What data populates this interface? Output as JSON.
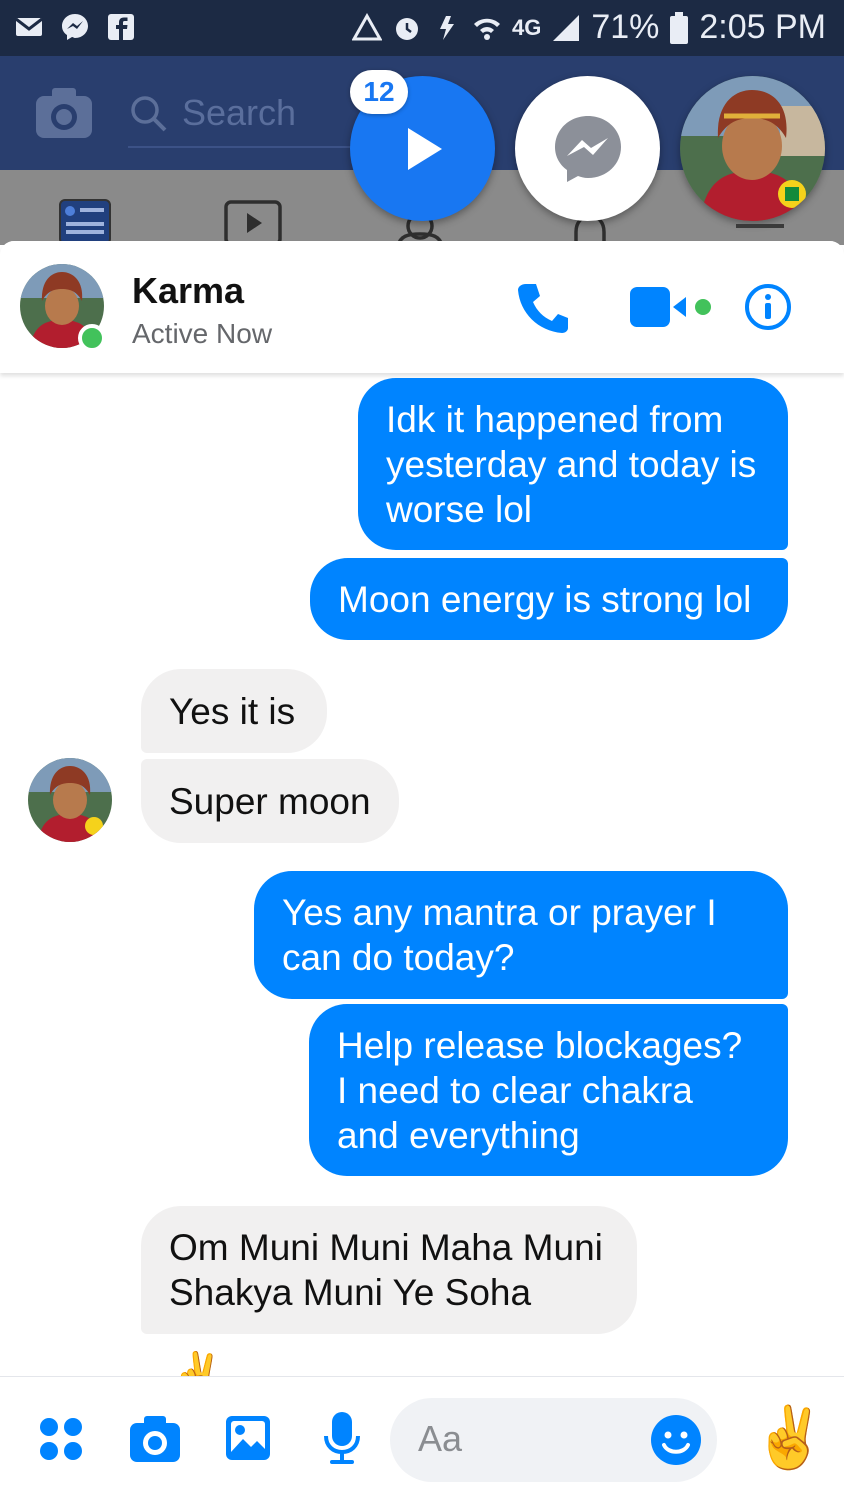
{
  "status_bar": {
    "battery": "71%",
    "time": "2:05 PM",
    "network": "4G"
  },
  "facebook_bar": {
    "search_placeholder": "Search"
  },
  "chat_heads": {
    "unread_count": "12"
  },
  "conversation": {
    "name": "Karma",
    "status": "Active Now"
  },
  "messages": [
    {
      "side": "out",
      "text": "Idk it happened from yesterday and today is worse lol"
    },
    {
      "side": "out",
      "text": "Moon energy is strong lol"
    },
    {
      "side": "in",
      "text": "Yes it is"
    },
    {
      "side": "in",
      "text": "Super moon"
    },
    {
      "side": "out",
      "text": "Yes any mantra or prayer I can do today?"
    },
    {
      "side": "out",
      "text": "Help release blockages? I need to clear chakra and everything"
    },
    {
      "side": "in",
      "text": "Om Muni Muni Maha Muni Shakya Muni Ye Soha"
    },
    {
      "side": "in",
      "text": "✌"
    }
  ],
  "composer": {
    "placeholder": "Aa",
    "quick_reaction": "✌"
  },
  "colors": {
    "accent": "#0084ff",
    "online": "#42c25b",
    "incoming": "#f1f0f0"
  }
}
